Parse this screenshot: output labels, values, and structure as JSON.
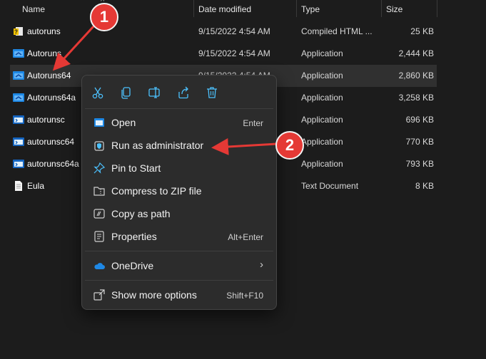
{
  "columns": {
    "name": "Name",
    "date": "Date modified",
    "type": "Type",
    "size": "Size"
  },
  "files": [
    {
      "name": "autoruns",
      "date": "9/15/2022 4:54 AM",
      "type": "Compiled HTML ...",
      "size": "25 KB",
      "icon": "help-file-icon"
    },
    {
      "name": "Autoruns",
      "date": "9/15/2022 4:54 AM",
      "type": "Application",
      "size": "2,444 KB",
      "icon": "app-icon"
    },
    {
      "name": "Autoruns64",
      "date": "9/15/2022 4:54 AM",
      "type": "Application",
      "size": "2,860 KB",
      "icon": "app-icon",
      "selected": true
    },
    {
      "name": "Autoruns64a",
      "date": "",
      "type": "Application",
      "size": "3,258 KB",
      "icon": "app-icon"
    },
    {
      "name": "autorunsc",
      "date": "",
      "type": "Application",
      "size": "696 KB",
      "icon": "console-app-icon"
    },
    {
      "name": "autorunsc64",
      "date": "",
      "type": "Application",
      "size": "770 KB",
      "icon": "console-app-icon"
    },
    {
      "name": "autorunsc64a",
      "date": "",
      "type": "Application",
      "size": "793 KB",
      "icon": "console-app-icon"
    },
    {
      "name": "Eula",
      "date": "",
      "type": "Text Document",
      "size": "8 KB",
      "icon": "text-file-icon"
    }
  ],
  "context_menu": {
    "quick_actions": [
      "cut-icon",
      "copy-icon",
      "rename-icon",
      "share-icon",
      "delete-icon"
    ],
    "items": [
      {
        "label": "Open",
        "shortcut": "Enter",
        "icon": "open-icon"
      },
      {
        "label": "Run as administrator",
        "shortcut": "",
        "icon": "shield-icon"
      },
      {
        "label": "Pin to Start",
        "shortcut": "",
        "icon": "pin-icon"
      },
      {
        "label": "Compress to ZIP file",
        "shortcut": "",
        "icon": "zip-folder-icon"
      },
      {
        "label": "Copy as path",
        "shortcut": "",
        "icon": "copy-path-icon"
      },
      {
        "label": "Properties",
        "shortcut": "Alt+Enter",
        "icon": "properties-icon"
      },
      {
        "label": "OneDrive",
        "shortcut": "",
        "icon": "cloud-icon"
      },
      {
        "label": "Show more options",
        "shortcut": "Shift+F10",
        "icon": "more-options-icon"
      }
    ]
  },
  "annotations": {
    "step1": "1",
    "step2": "2"
  },
  "colors": {
    "background": "#1c1c1c",
    "menu": "#2c2c2c",
    "accent_blue": "#4cc2ff",
    "annotation_red": "#e53935"
  }
}
